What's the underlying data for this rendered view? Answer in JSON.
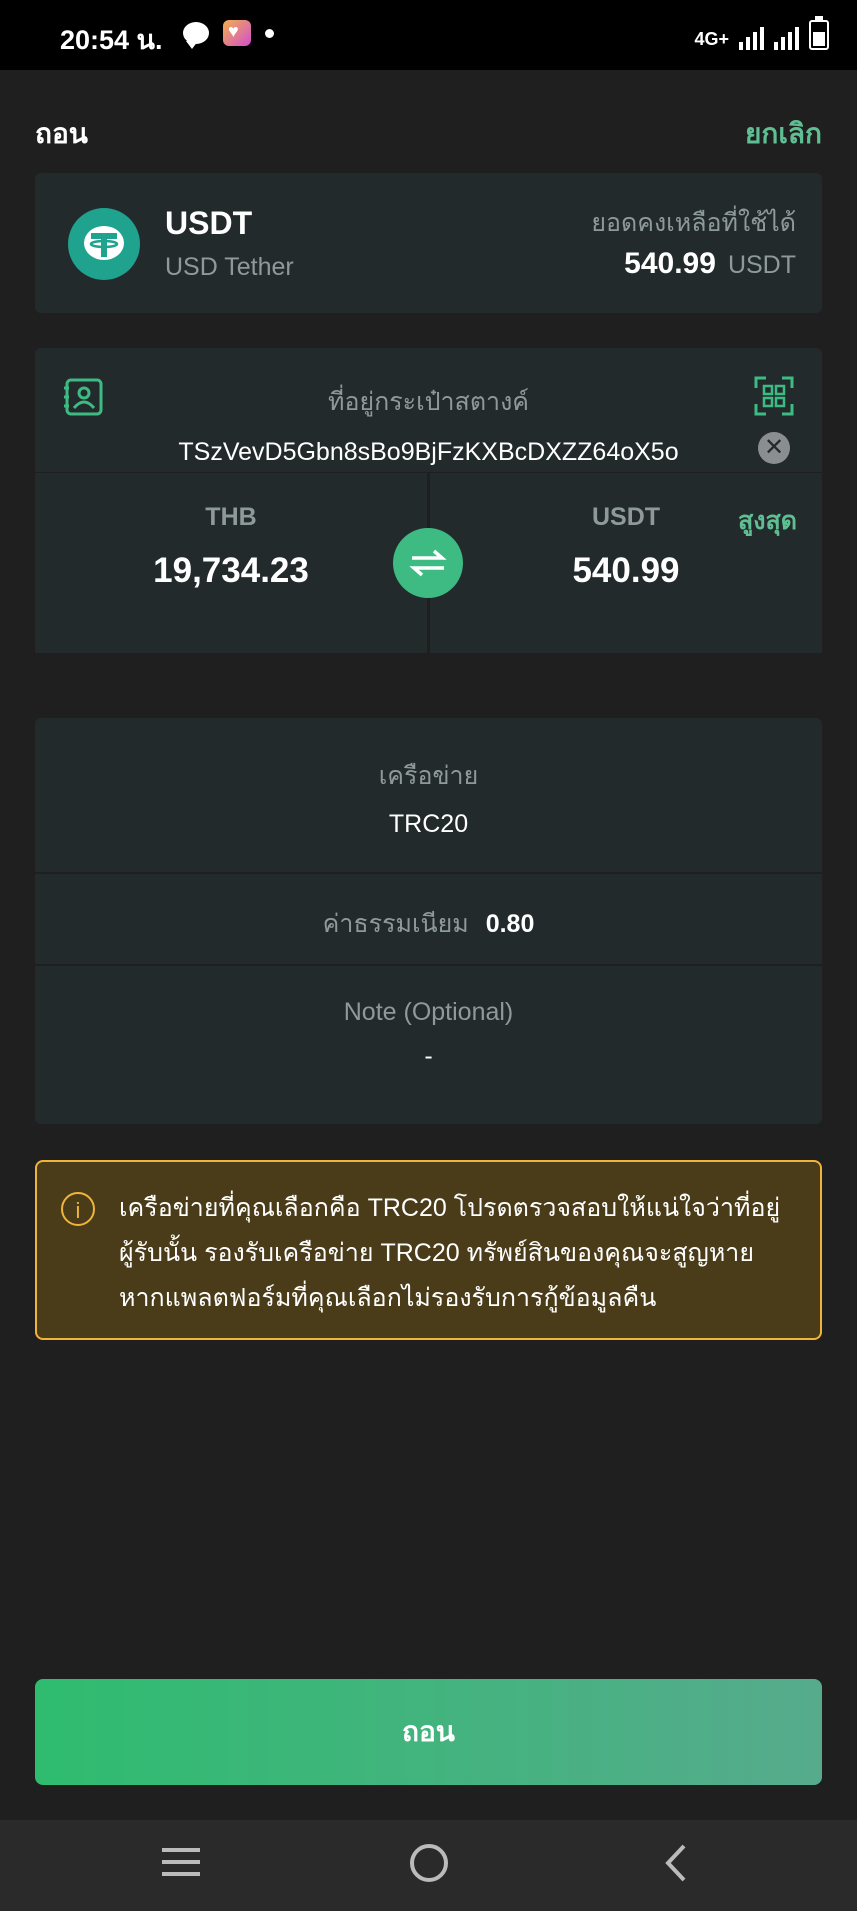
{
  "status_bar": {
    "time": "20:54 น.",
    "network": "4G+"
  },
  "header": {
    "title": "ถอน",
    "cancel_label": "ยกเลิก"
  },
  "asset": {
    "symbol": "USDT",
    "name": "USD Tether",
    "balance_label": "ยอดคงเหลือที่ใช้ได้",
    "balance_value": "540.99",
    "balance_unit": "USDT"
  },
  "address": {
    "label": "ที่อยู่กระเป๋าสตางค์",
    "value": "TSzVevD5Gbn8sBo9BjFzKXBcDXZZ64oX5o"
  },
  "amount": {
    "fiat_currency": "THB",
    "fiat_value": "19,734.23",
    "crypto_currency": "USDT",
    "crypto_value": "540.99",
    "max_label": "สูงสุด"
  },
  "network": {
    "label": "เครือข่าย",
    "value": "TRC20"
  },
  "fee": {
    "label": "ค่าธรรมเนียม",
    "value": "0.80"
  },
  "note": {
    "label": "Note (Optional)",
    "value": "-"
  },
  "warning": {
    "text": "เครือข่ายที่คุณเลือกคือ TRC20 โปรดตรวจสอบให้แน่ใจว่าที่อยู่ผู้รับนั้น รองรับเครือข่าย TRC20 ทรัพย์สินของคุณจะสูญหาย หากแพลตฟอร์มที่คุณเลือกไม่รองรับการกู้ข้อมูลคืน"
  },
  "actions": {
    "withdraw_label": "ถอน"
  },
  "colors": {
    "accent": "#5fbf93",
    "background": "#1f1f1f",
    "card": "#232a2c",
    "warning_border": "#f0b43a",
    "warning_bg": "#4a3c19",
    "tether": "#1fa38f"
  },
  "icons": [
    "chat-icon",
    "app-icon",
    "signal-icon",
    "battery-icon",
    "tether-logo-icon",
    "address-book-icon",
    "qr-scan-icon",
    "clear-icon",
    "swap-icon",
    "info-icon",
    "menu-icon",
    "home-icon",
    "back-icon"
  ]
}
